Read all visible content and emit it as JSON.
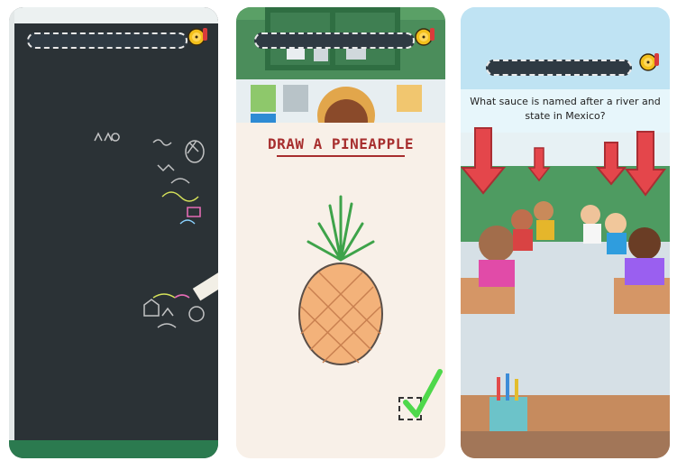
{
  "screens": [
    {
      "id": "chalkboard",
      "timer_icon": "alarm-bell-icon"
    },
    {
      "id": "draw-prompt",
      "prompt": "DRAW A PINEAPPLE",
      "timer_icon": "alarm-bell-icon",
      "check_icon": "checkmark-icon"
    },
    {
      "id": "classroom-quiz",
      "question": "What sauce is named after a river and state in Mexico?",
      "timer_icon": "alarm-bell-icon",
      "arrow_icon": "down-arrow-icon"
    }
  ],
  "colors": {
    "chalkboard": "#2b3236",
    "wall_green": "#4b8d5b",
    "prompt_red": "#a72e2e",
    "arrow_red": "#e4464b",
    "bell_yellow": "#f3c01b",
    "check_green": "#4ed84b"
  }
}
